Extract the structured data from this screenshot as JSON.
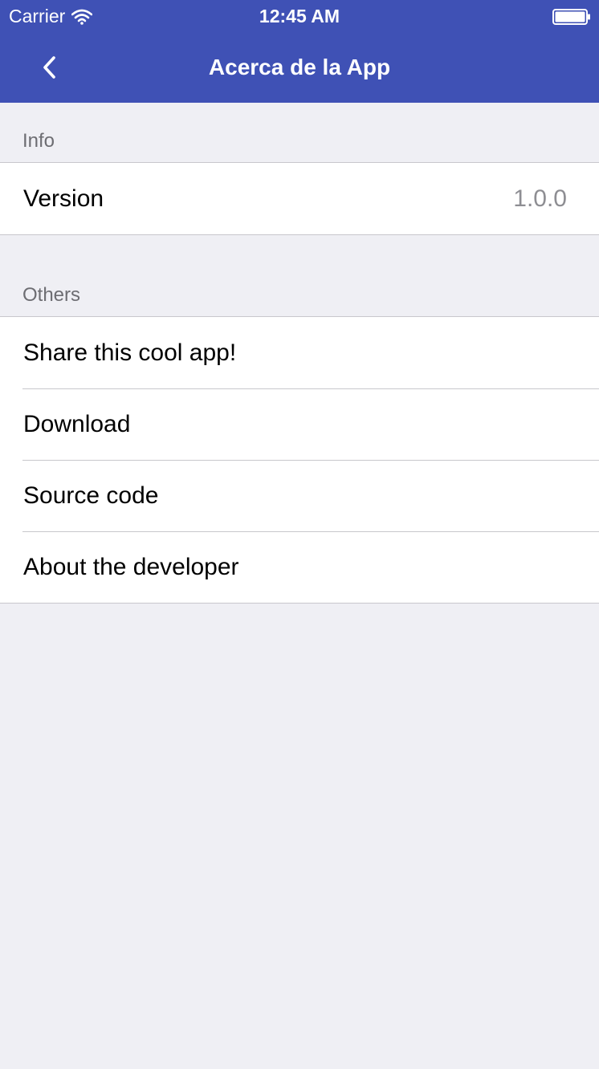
{
  "status_bar": {
    "carrier": "Carrier",
    "time": "12:45 AM"
  },
  "nav": {
    "title": "Acerca de la App"
  },
  "sections": {
    "info": {
      "header": "Info",
      "version_label": "Version",
      "version_value": "1.0.0"
    },
    "others": {
      "header": "Others",
      "items": [
        "Share this cool app!",
        "Download",
        "Source code",
        "About the developer"
      ]
    }
  },
  "colors": {
    "nav_bar": "#3f51b5",
    "background": "#efeff4",
    "secondary_text": "#8e8e93"
  },
  "icons": {
    "back": "chevron-left-icon",
    "wifi": "wifi-icon",
    "battery": "battery-icon"
  }
}
